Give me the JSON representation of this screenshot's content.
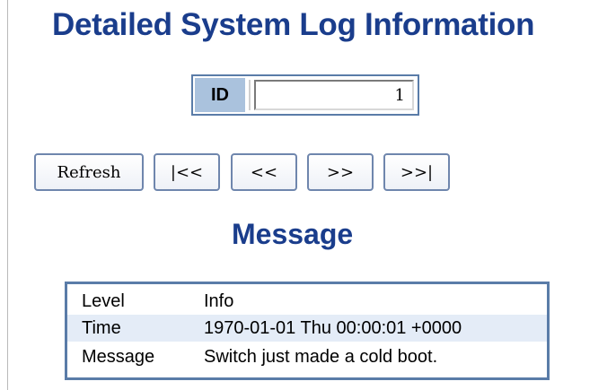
{
  "title": "Detailed System Log Information",
  "id_selector": {
    "label": "ID",
    "value": "1"
  },
  "buttons": {
    "refresh": "Refresh",
    "first": "|<<",
    "prev": "<<",
    "next": ">>",
    "last": ">>|"
  },
  "message_section": {
    "title": "Message",
    "rows": [
      {
        "key": "Level",
        "value": "Info"
      },
      {
        "key": "Time",
        "value": "1970-01-01 Thu 00:00:01 +0000"
      },
      {
        "key": "Message",
        "value": "Switch just made a cold boot."
      }
    ]
  },
  "colors": {
    "title_blue": "#1a3d8c",
    "border_blue": "#5a7ca8",
    "label_bg": "#aac2dd",
    "row_alt": "#e4ecf7"
  }
}
